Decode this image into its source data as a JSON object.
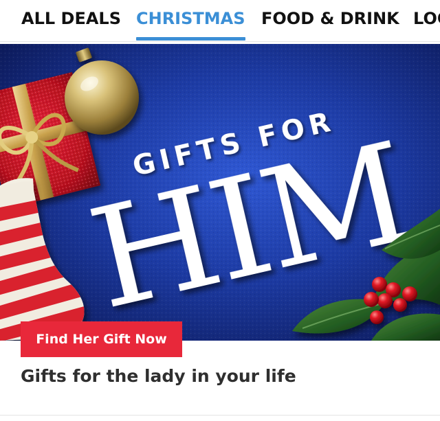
{
  "nav": {
    "tabs": [
      {
        "label": "ALL DEALS",
        "active": false
      },
      {
        "label": "CHRISTMAS",
        "active": true
      },
      {
        "label": "FOOD & DRINK",
        "active": false
      },
      {
        "label": "LOC",
        "active": false
      }
    ],
    "active_color": "#3b8fd6"
  },
  "hero": {
    "headline_top": "GIFTS FOR",
    "headline_main": "HIM",
    "background_color": "#1b3598"
  },
  "promo": {
    "cta_label": "Find Her Gift Now",
    "cta_color": "#e8283a",
    "subtitle": "Gifts for the lady in your life"
  }
}
